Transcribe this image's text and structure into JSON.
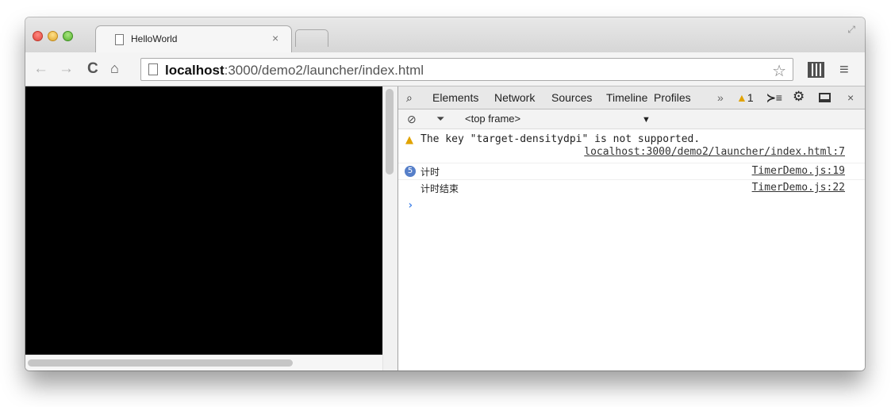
{
  "browser": {
    "tab_title": "HelloWorld",
    "tab_close": "×",
    "url_host": "localhost",
    "url_rest": ":3000/demo2/launcher/index.html",
    "star_icon": "star-icon",
    "menu_icon": "hamburger-menu-icon"
  },
  "devtools": {
    "tabs": {
      "elements": "Elements",
      "network": "Network",
      "sources": "Sources",
      "timeline": "Timeline",
      "profiles": "Profiles",
      "more": "»",
      "warning_count": "1",
      "console_icon": "≻≡",
      "close": "×"
    },
    "filter": {
      "frame": "<top frame>"
    },
    "console": {
      "warning_text": "The key \"target-densitydpi\" is not supported.",
      "warning_source": "localhost:3000/demo2/launcher/index.html:7",
      "message1_count": "5",
      "message1_text": "计时",
      "message1_source": "TimerDemo.js:19",
      "message2_text": "计时结束",
      "message2_source": "TimerDemo.js:22",
      "prompt": "›"
    }
  },
  "colors": {
    "warning": "#e1a300",
    "badge": "#567fc9",
    "prompt": "#3f80e8"
  }
}
